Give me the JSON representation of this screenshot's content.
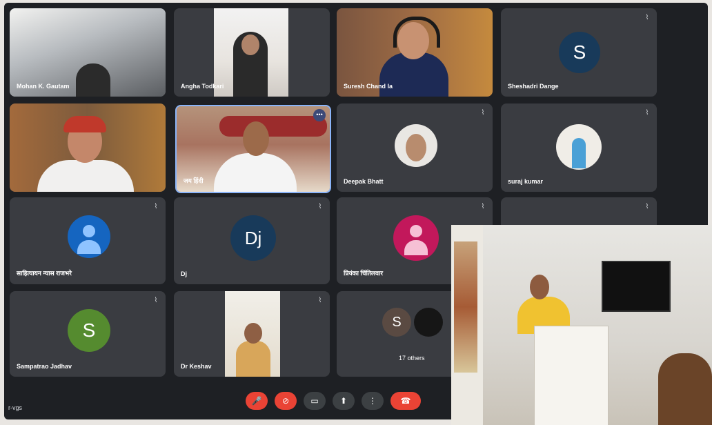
{
  "participants": [
    {
      "name": "Mohan K. Gautam",
      "type": "video"
    },
    {
      "name": "Angha Todkari",
      "type": "video"
    },
    {
      "name": "Suresh Chand     la",
      "type": "video"
    },
    {
      "name": "Sheshadri Dange",
      "type": "avatar",
      "initial": "S",
      "color": "#183a5a"
    },
    {
      "name": "",
      "type": "video"
    },
    {
      "name": "जय हिंदी",
      "type": "video"
    },
    {
      "name": "Deepak Bhatt",
      "type": "photo"
    },
    {
      "name": "suraj kumar",
      "type": "photo"
    },
    {
      "name": "साहित्यायन न्यास राजभरे",
      "type": "avatar-icon",
      "color": "#1565c0"
    },
    {
      "name": "Dj",
      "type": "avatar",
      "initial": "Dj",
      "color": "#183a5a"
    },
    {
      "name": "प्रियंका चिंतिलवार",
      "type": "avatar-icon",
      "color": "#c2185b"
    },
    {
      "name": "Sampatrao Jadhav",
      "type": "avatar",
      "initial": "S",
      "color": "#558b2f"
    },
    {
      "name": "Dr Keshav",
      "type": "video"
    },
    {
      "name": "17 others",
      "type": "others",
      "initial": "S"
    }
  ],
  "controls": [
    {
      "name": "mic-off-button",
      "icon": "mic-off-icon",
      "glyph": "🎤"
    },
    {
      "name": "camera-off-button",
      "icon": "camera-off-icon",
      "glyph": "⊘"
    },
    {
      "name": "captions-button",
      "icon": "captions-icon",
      "glyph": "▭"
    },
    {
      "name": "present-button",
      "icon": "present-icon",
      "glyph": "⬆"
    },
    {
      "name": "more-options-button",
      "icon": "more-vert-icon",
      "glyph": "⋮"
    },
    {
      "name": "leave-call-button",
      "icon": "call-end-icon",
      "glyph": "☎"
    }
  ],
  "footer_left_text": "r-vgs",
  "colors": {
    "background": "#1e2024",
    "tile": "#3a3c41",
    "active_border": "#8ab4f8",
    "danger": "#ea4335"
  }
}
